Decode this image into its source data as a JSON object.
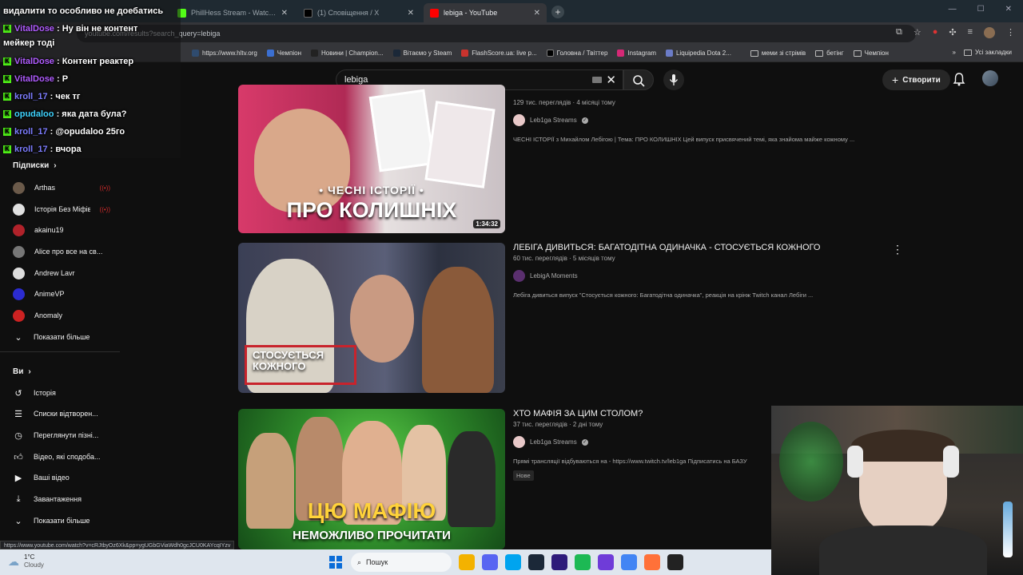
{
  "browser": {
    "tabs": [
      {
        "title": "PhillHess Stream - Watch Live",
        "fav": "#53fc18"
      },
      {
        "title": "(1) Сповіщення / X",
        "fav": "#000000"
      },
      {
        "title": "lebiga - YouTube",
        "fav": "#ff0000",
        "active": true
      }
    ],
    "url": "youtube.com/results?search_query=lebiga",
    "bookmarks": [
      {
        "label": "https://www.hltv.org",
        "color": "#2f4b6e"
      },
      {
        "label": "Чемпіон",
        "color": "#3b6fd1"
      },
      {
        "label": "Новини | Champion...",
        "color": "#222222"
      },
      {
        "label": "Вітаємо у Steam",
        "color": "#1b2838"
      },
      {
        "label": "FlashScore.ua: live р...",
        "color": "#c9332e"
      },
      {
        "label": "Головна / Твіттер",
        "color": "#000000"
      },
      {
        "label": "Instagram",
        "color": "#d62976"
      },
      {
        "label": "Liquipedia Dota 2...",
        "color": "#6b7cc8"
      }
    ],
    "bookmark_folders": [
      "меми зі стрімів",
      "бетінг",
      "Чемпіон"
    ],
    "all_bookmarks": "Усі закладки"
  },
  "youtube": {
    "search_value": "lebiga",
    "create_label": "Створити",
    "sidebar": {
      "subscriptions_title": "Підписки",
      "channels": [
        {
          "name": "Arthas",
          "live": true,
          "color": "#6b5a4a"
        },
        {
          "name": "Історія Без Міфів",
          "live": true,
          "color": "#e0e0e0"
        },
        {
          "name": "akainu19",
          "live": false,
          "color": "#b0222a"
        },
        {
          "name": "Alice про все на св...",
          "live": false,
          "color": "#777777"
        },
        {
          "name": "Andrew Lavr",
          "live": false,
          "color": "#dddddd"
        },
        {
          "name": "AnimeVP",
          "live": false,
          "color": "#2b2bd0"
        },
        {
          "name": "Anomaly",
          "live": false,
          "color": "#cc2222"
        }
      ],
      "show_more_1": "Показати більше",
      "you_title": "Ви",
      "you_items": [
        {
          "label": "Історія",
          "icon": "history-icon"
        },
        {
          "label": "Списки відтворен...",
          "icon": "playlists-icon"
        },
        {
          "label": "Переглянути пізні...",
          "icon": "watch-later-icon"
        },
        {
          "label": "Відео, які сподоба...",
          "icon": "liked-icon"
        },
        {
          "label": "Ваші відео",
          "icon": "your-videos-icon"
        },
        {
          "label": "Завантаження",
          "icon": "download-icon"
        }
      ],
      "show_more_2": "Показати більше"
    },
    "results": [
      {
        "title": "",
        "stats": "129 тис. переглядів · 4 місяці тому",
        "channel": "Leb1ga Streams",
        "verified": true,
        "desc": "ЧЕСНІ ІСТОРІЇ з Михайлом Лебігою | Тема: ПРО КОЛИШНІХ Цей випуск присвячений темі, яка знайома майже кожному ...",
        "duration": "1:34:32",
        "thumb_small": "• ЧЕСНІ ІСТОРІЇ •",
        "thumb_big": "ПРО КОЛИШНІХ"
      },
      {
        "title": "ЛЕБІГА ДИВИТЬСЯ: БАГАТОДІТНА ОДИНАЧКА - СТОСУЄТЬСЯ КОЖНОГО",
        "stats": "60 тис. переглядів · 5 місяців тому",
        "channel": "LebigA Moments",
        "verified": false,
        "desc": "Лебіга дивиться випуск \"Стосується кожного: Багатодітна одиначка\", реакція на крінж Twitch канал Лебіги ...",
        "thumb_big": "СТОСУЄТЬСЯ КОЖНОГО"
      },
      {
        "title": "ХТО МАФІЯ ЗА ЦИМ СТОЛОМ?",
        "stats": "37 тис. переглядів · 2 дні тому",
        "channel": "Leb1ga Streams",
        "verified": true,
        "desc": "Прямі трансляції відбуваються на - https://www.twitch.tv/leb1ga Підписатись на БАЗУ",
        "badge": "Нове",
        "thumb_big": "ЦЮ МАФІЮ",
        "thumb_small": "НЕМОЖЛИВО ПРОЧИТАТИ"
      }
    ],
    "status_url": "https://www.youtube.com/watch?v=cRJtbyOz6Xk&pp=ygUGbGViaWdh0gcJCU0KAYcqIYzv"
  },
  "chat": {
    "header": "видалити то особливо не доебатись",
    "messages": [
      {
        "user": "VitalDose",
        "text": ": Ну він не контент",
        "cls": ""
      },
      {
        "user": "",
        "text": "мейкер тоді",
        "cls": ""
      },
      {
        "user": "VitalDose",
        "text": ": Контент реактер",
        "cls": ""
      },
      {
        "user": "VitalDose",
        "text": ": Р",
        "cls": ""
      },
      {
        "user": "kroll_17",
        "text": ": чек тг",
        "cls": "c3"
      },
      {
        "user": "opudaloo",
        "text": ": яка дата була?",
        "cls": "c2"
      },
      {
        "user": "kroll_17",
        "text": ": @opudaloo 25го",
        "cls": "c3"
      },
      {
        "user": "kroll_17",
        "text": ": вчора",
        "cls": "c3"
      }
    ]
  },
  "taskbar": {
    "temp": "1°C",
    "weather": "Cloudy",
    "search": "Пошук",
    "apps": [
      "#f3b200",
      "#5865f2",
      "#00a4ef",
      "#1b2838",
      "#2e1b7a",
      "#1db954",
      "#6f3cd8",
      "#4285f4",
      "#ff7139",
      "#222222"
    ]
  }
}
